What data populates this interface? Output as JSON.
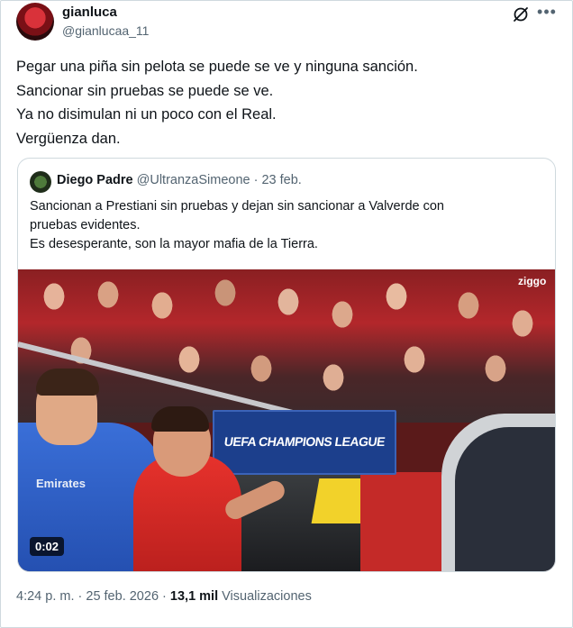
{
  "author": {
    "name": "gianluca",
    "handle": "@gianlucaa_11"
  },
  "tweet": {
    "lines": [
      "Pegar una piña sin pelota se puede se ve y ninguna sanción.",
      "Sancionar sin pruebas se puede se ve.",
      "Ya no disimulan ni un poco con el Real.",
      "Vergüenza dan."
    ]
  },
  "quote": {
    "name": "Diego Padre",
    "handle": "@UltranzaSimeone",
    "separator": " · ",
    "date": "23 feb.",
    "lines": [
      "Sancionan a Prestiani sin pruebas y dejan sin sancionar a Valverde con",
      "pruebas evidentes.",
      "Es desesperante, son la mayor mafia de la Tierra."
    ],
    "media": {
      "board_text": "UEFA CHAMPIONS LEAGUE",
      "sponsor_text": "Emirates",
      "corner_text": "ziggo",
      "duration": "0:02"
    }
  },
  "footer": {
    "time": "4:24 p. m.",
    "dot1": " · ",
    "date": "25 feb. 2026",
    "dot2": " · ",
    "views_count": "13,1 mil",
    "views_label": " Visualizaciones"
  },
  "icons": {
    "grok": "grok-slash-icon",
    "more": "more-dots-icon"
  }
}
